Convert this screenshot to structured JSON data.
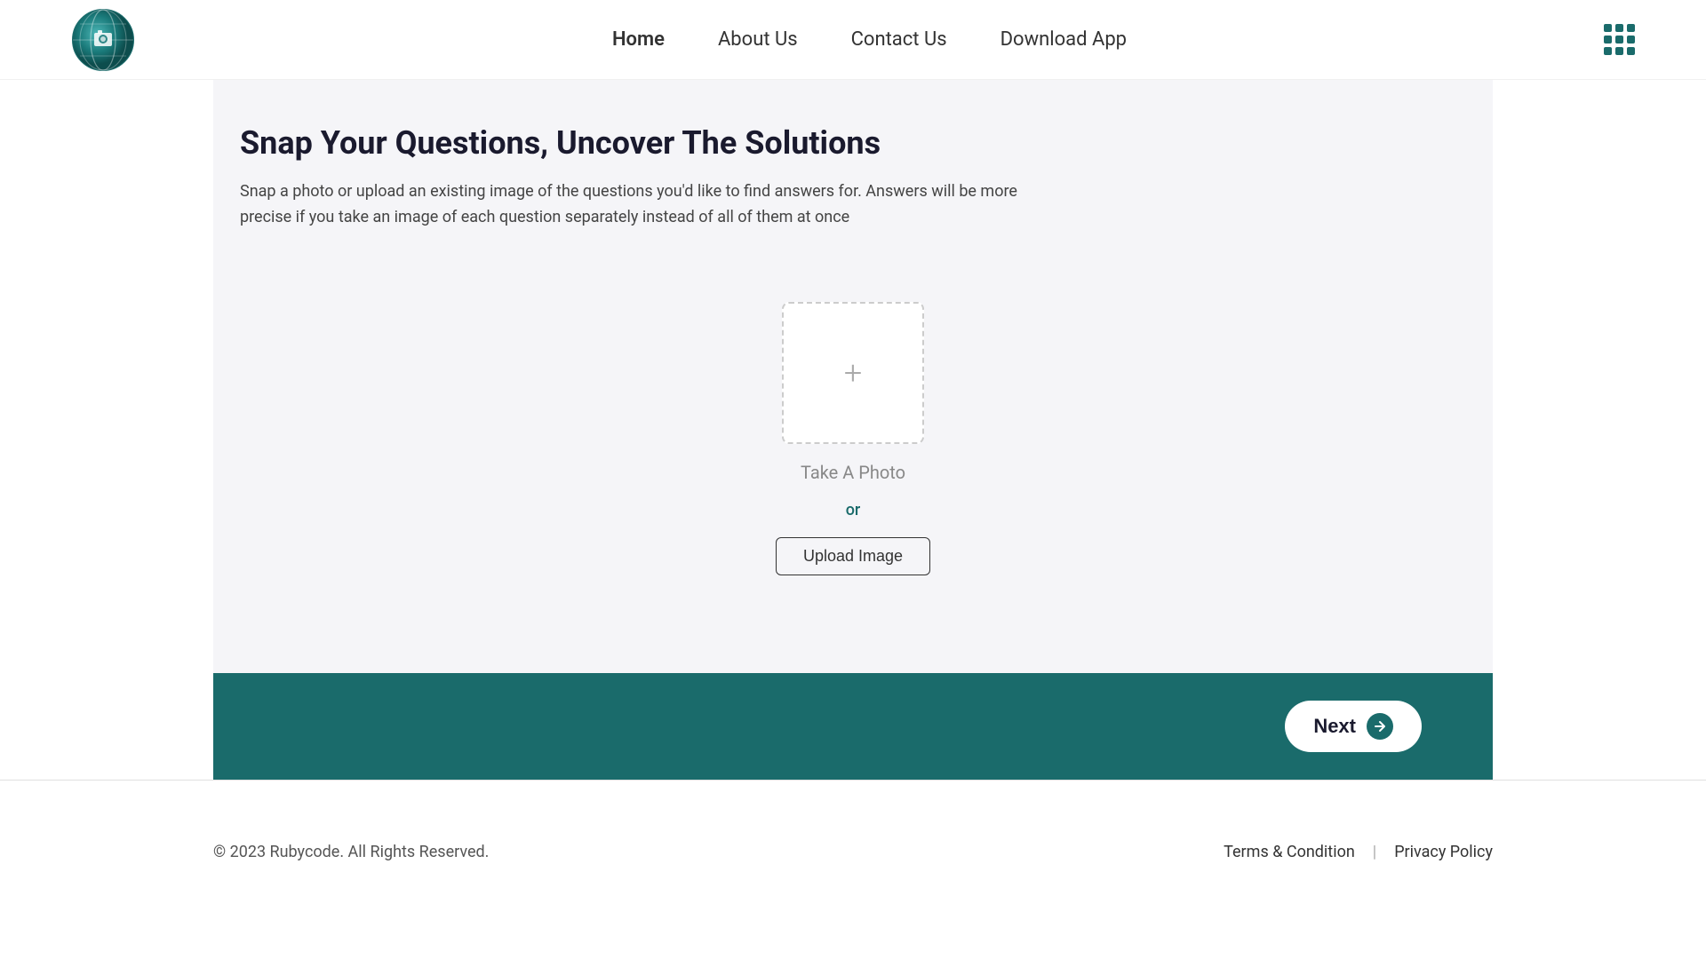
{
  "header": {
    "logo_alt": "Snap and Solve logo",
    "nav": {
      "home": "Home",
      "about": "About Us",
      "contact": "Contact Us",
      "download": "Download App"
    },
    "grid_icon_label": "apps grid"
  },
  "main": {
    "title": "Snap Your Questions, Uncover The Solutions",
    "description": "Snap a photo or upload an existing image of the questions you'd like to find answers for. Answers will be more precise if you take an image of each question separately instead of all of them at once",
    "upload": {
      "take_photo": "Take A Photo",
      "or_text": "or",
      "upload_button": "Upload Image",
      "plus_icon": "+"
    },
    "next_button": "Next"
  },
  "footer": {
    "copyright": "© 2023 Rubycode. All Rights Reserved.",
    "terms": "Terms & Condition",
    "privacy": "Privacy Policy"
  }
}
